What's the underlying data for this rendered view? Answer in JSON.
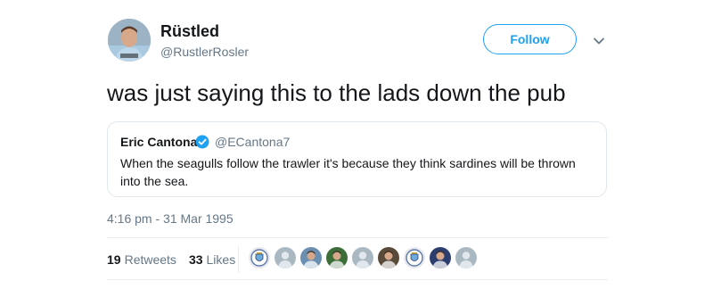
{
  "tweet": {
    "author": {
      "display_name": "Rüstled",
      "handle": "@RustlerRosler",
      "avatar_icon": "user-avatar-icon"
    },
    "follow_label": "Follow",
    "text": "was just saying this to the lads down the pub",
    "quoted": {
      "display_name": "Eric Cantona",
      "handle": "@ECantona7",
      "verified": true,
      "text": "When the seagulls follow the trawler it's because they think sardines will be thrown into the sea."
    },
    "timestamp": "4:16 pm - 31 Mar 1995",
    "stats": {
      "retweets_count": "19",
      "retweets_label": "Retweets",
      "likes_count": "33",
      "likes_label": "Likes"
    },
    "liker_avatars": [
      {
        "icon": "crest-avatar-icon",
        "bg": "#e8e8ee"
      },
      {
        "icon": "default-avatar-icon",
        "bg": "#aab8c2"
      },
      {
        "icon": "photo-avatar-icon",
        "bg": "#6a8fb0"
      },
      {
        "icon": "photo-avatar-icon",
        "bg": "#3c6e3a"
      },
      {
        "icon": "default-avatar-icon",
        "bg": "#aab8c2"
      },
      {
        "icon": "photo-avatar-icon",
        "bg": "#5a4a3a"
      },
      {
        "icon": "crest-avatar-icon",
        "bg": "#e8e8ee"
      },
      {
        "icon": "photo-avatar-icon",
        "bg": "#2c3e6e"
      },
      {
        "icon": "default-avatar-icon",
        "bg": "#aab8c2"
      }
    ]
  },
  "colors": {
    "accent": "#1da1f2",
    "secondary_text": "#657786",
    "border": "#e1e8ed"
  }
}
